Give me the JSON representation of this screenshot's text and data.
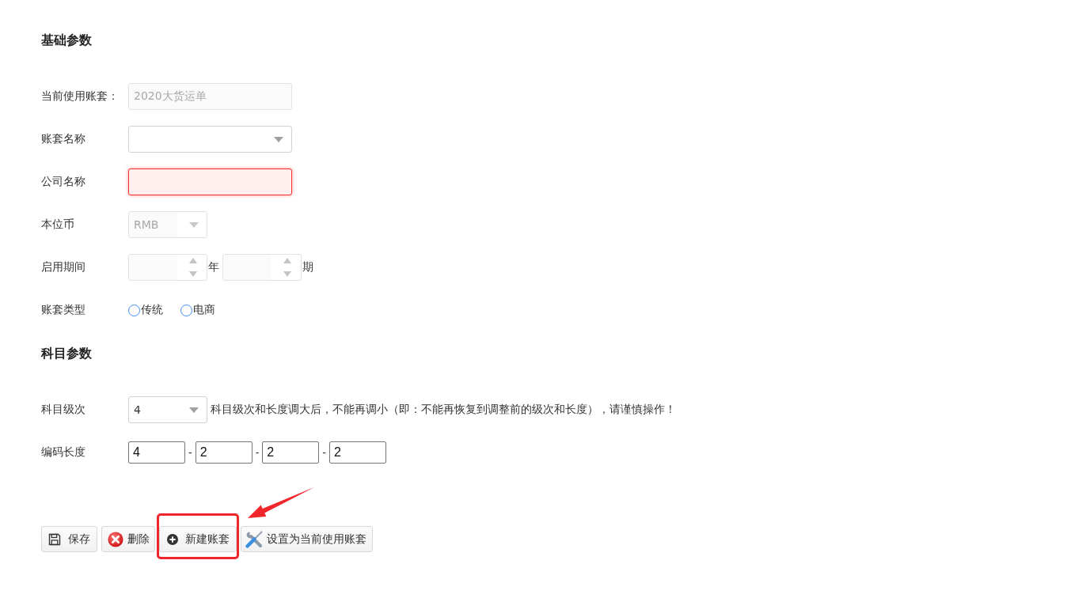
{
  "sections": [
    {
      "title": "基础参数",
      "fields": [
        {
          "kind": "text",
          "label": "当前使用账套：",
          "value": "2020大货运单",
          "disabled": true,
          "invalid": false
        },
        {
          "kind": "select",
          "label": "账套名称",
          "disabled": false,
          "invalid": false
        },
        {
          "kind": "text",
          "label": "公司名称",
          "disabled": false,
          "invalid": true
        },
        {
          "kind": "select",
          "label": "本位币",
          "value": "RMB",
          "disabled": true,
          "invalid": false
        },
        {
          "kind": "period",
          "label": "启用期间",
          "disabled": true,
          "invalid": false,
          "parts": [
            {
              "unit": "年"
            },
            {
              "unit": "期"
            }
          ]
        },
        {
          "kind": "radio",
          "label": "账套类型",
          "disabled": false,
          "invalid": false,
          "options": [
            {
              "label": "传统",
              "selected": false
            },
            {
              "label": "电商",
              "selected": false
            }
          ]
        }
      ]
    },
    {
      "title": "科目参数",
      "fields": [
        {
          "kind": "select",
          "label": "科目级次",
          "value": "4",
          "disabled": false,
          "invalid": false,
          "note": "科目级次和长度调大后，不能再调小（即：不能再恢复到调整前的级次和长度），请谨慎操作！"
        },
        {
          "kind": "segments",
          "label": "编码长度",
          "disabled": false,
          "invalid": false,
          "values": [
            "4",
            "2",
            "2",
            "2"
          ],
          "separators": [
            "-",
            "-",
            "-"
          ]
        }
      ]
    }
  ],
  "buttons": [
    {
      "kind": "save",
      "label": "保存",
      "highlighted": false
    },
    {
      "kind": "delete",
      "label": "删除",
      "highlighted": false
    },
    {
      "kind": "create",
      "label": "新建账套",
      "highlighted": true
    },
    {
      "kind": "set-current",
      "label": "设置为当前使用账套",
      "highlighted": false
    }
  ]
}
